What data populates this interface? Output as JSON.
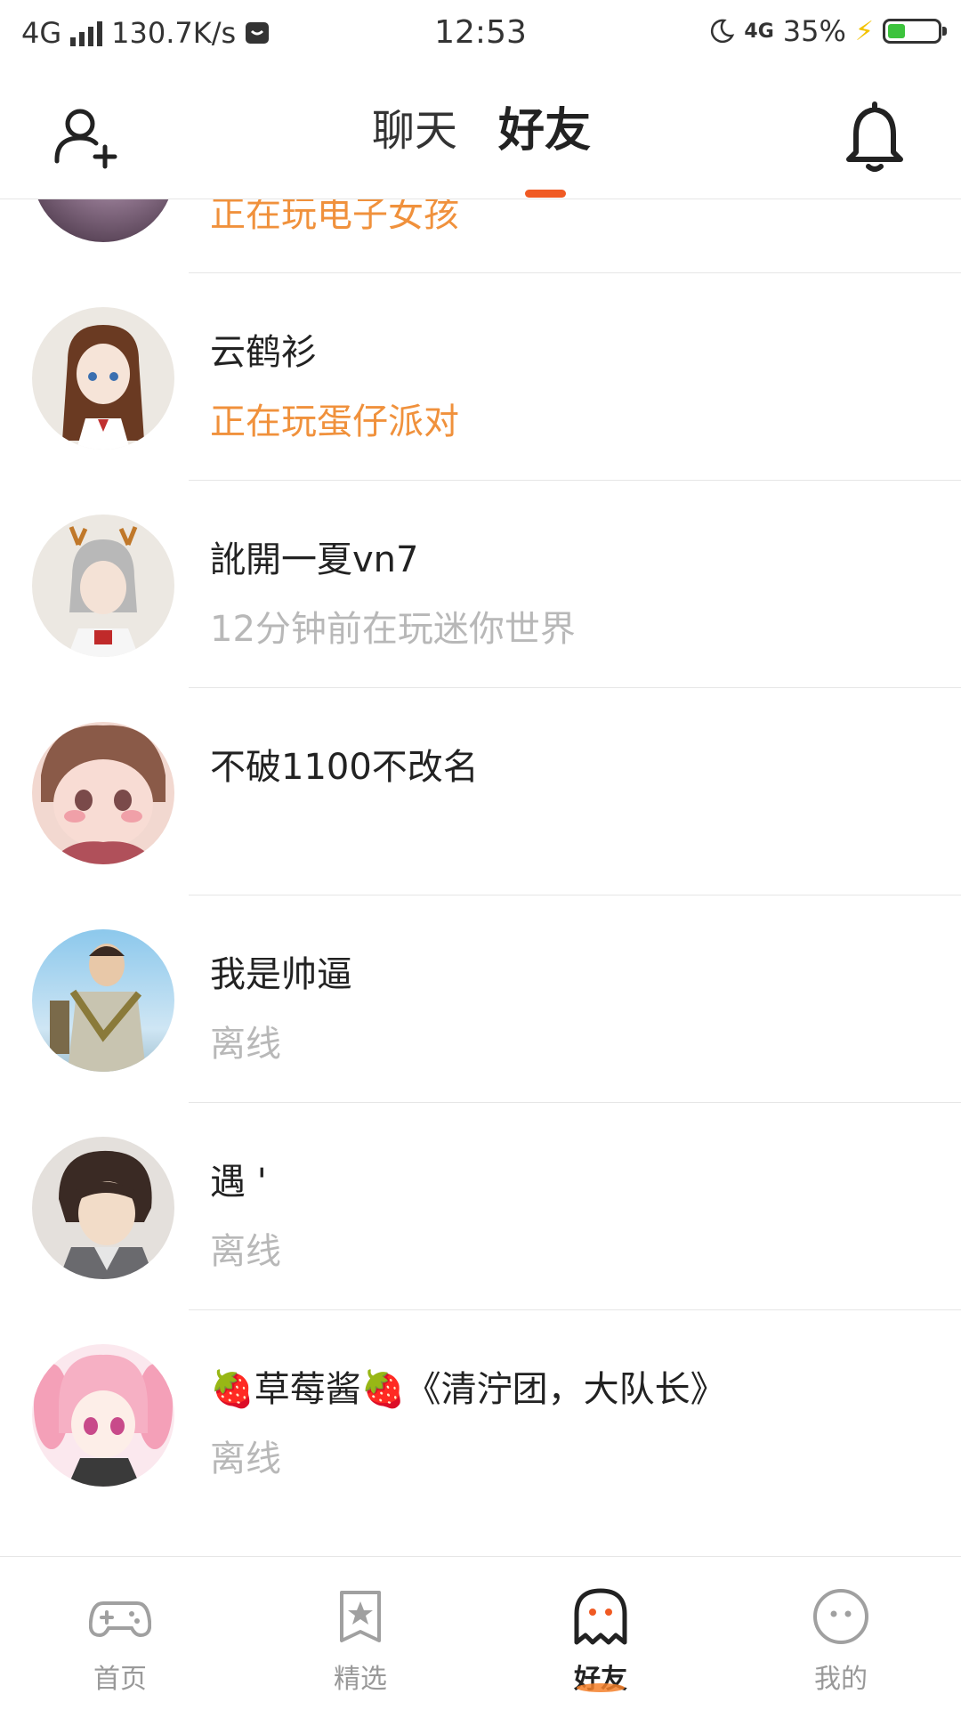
{
  "status_bar": {
    "network": "4G",
    "speed": "130.7K/s",
    "time": "12:53",
    "network2": "4G",
    "battery": "35%",
    "battery_level": 0.35
  },
  "header": {
    "tabs": [
      {
        "label": "聊天",
        "active": false
      },
      {
        "label": "好友",
        "active": true
      }
    ],
    "accent_color": "#f05a23"
  },
  "friends": [
    {
      "name": "",
      "status": "正在玩电子女孩",
      "status_type": "playing"
    },
    {
      "name": "云鹤衫",
      "status": "正在玩蛋仔派对",
      "status_type": "playing"
    },
    {
      "name": "訛開一夏vn7",
      "status": "12分钟前在玩迷你世界",
      "status_type": "offline"
    },
    {
      "name": "不破1100不改名",
      "status": "",
      "status_type": "none"
    },
    {
      "name": "我是帅逼",
      "status": "离线",
      "status_type": "offline"
    },
    {
      "name": "遇 '",
      "status": "离线",
      "status_type": "offline"
    },
    {
      "name": "🍓草莓酱🍓《清泞团，大队长》",
      "status": "离线",
      "status_type": "offline"
    }
  ],
  "tabbar": {
    "items": [
      {
        "label": "首页",
        "icon": "gamepad-icon",
        "active": false
      },
      {
        "label": "精选",
        "icon": "star-bookmark-icon",
        "active": false
      },
      {
        "label": "好友",
        "icon": "ghost-icon",
        "active": true
      },
      {
        "label": "我的",
        "icon": "face-icon",
        "active": false
      }
    ]
  }
}
